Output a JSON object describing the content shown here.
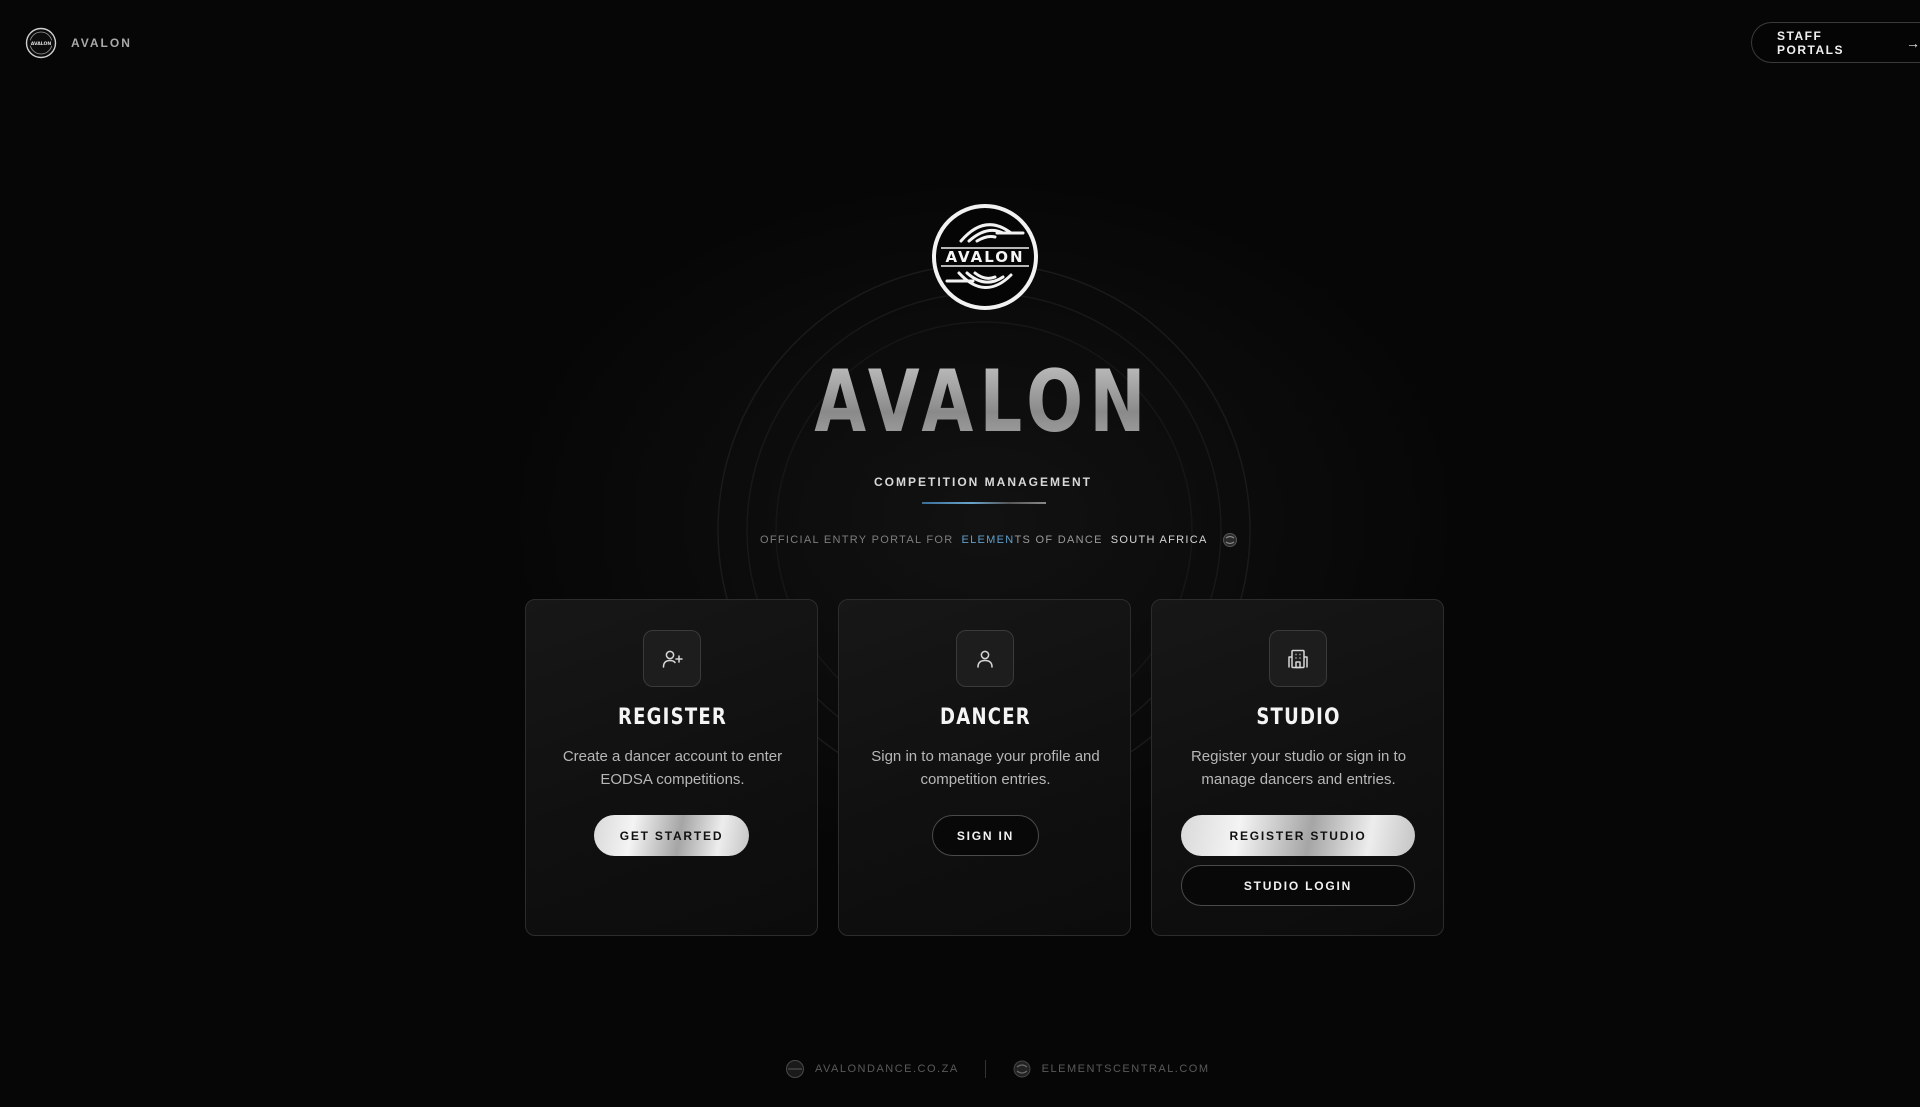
{
  "header": {
    "brand": "AVALON",
    "logo_icon": "avalon-seal-logo",
    "staff_button": {
      "label": "STAFF PORTALS",
      "icon": "arrow-right-icon"
    }
  },
  "hero": {
    "logo_icon": "avalon-seal-logo",
    "logo_text": "AVALON",
    "title": "AVALON",
    "subtitle": "COMPETITION MANAGEMENT",
    "tagline": {
      "prefix": "OFFICIAL ENTRY PORTAL FOR",
      "accent": "ELEMEN",
      "mid": "TS OF DANCE",
      "suffix": "SOUTH AFRICA",
      "icon": "elements-logo-icon"
    }
  },
  "cards": [
    {
      "icon": "user-plus-icon",
      "title": "REGISTER",
      "description": "Create a dancer account to enter EODSA competitions.",
      "buttons": [
        {
          "label": "GET STARTED",
          "style": "silver"
        }
      ]
    },
    {
      "icon": "user-icon",
      "title": "DANCER",
      "description": "Sign in to manage your profile and competition entries.",
      "buttons": [
        {
          "label": "SIGN IN",
          "style": "outline"
        }
      ]
    },
    {
      "icon": "building-icon",
      "title": "STUDIO",
      "description": "Register your studio or sign in to manage dancers and entries.",
      "buttons": [
        {
          "label": "REGISTER STUDIO",
          "style": "silver"
        },
        {
          "label": "STUDIO LOGIN",
          "style": "outline"
        }
      ]
    }
  ],
  "footer": {
    "links": [
      {
        "label": "AVALONDANCE.CO.ZA",
        "icon": "avalon-mini-icon"
      },
      {
        "label": "ELEMENTSCENTRAL.COM",
        "icon": "elements-mini-icon"
      }
    ]
  },
  "colors": {
    "background": "#060606",
    "accent_blue": "#5f9fcc",
    "card_border": "#2c2c2c"
  }
}
